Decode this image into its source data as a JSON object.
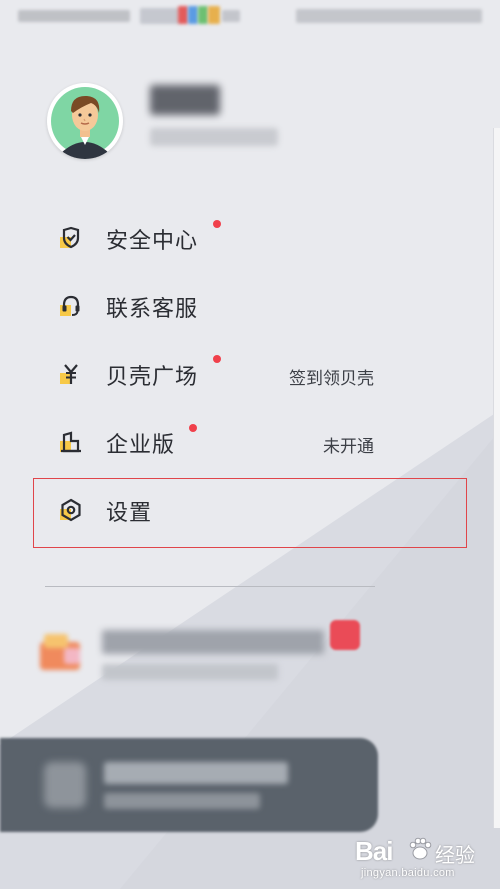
{
  "menu": {
    "items": [
      {
        "label": "安全中心",
        "icon": "shield-icon",
        "badge": true,
        "right_text": ""
      },
      {
        "label": "联系客服",
        "icon": "headset-icon",
        "badge": false,
        "right_text": ""
      },
      {
        "label": "贝壳广场",
        "icon": "yen-icon",
        "badge": true,
        "right_text": "签到领贝壳"
      },
      {
        "label": "企业版",
        "icon": "enterprise-icon",
        "badge": true,
        "right_text": "未开通"
      },
      {
        "label": "设置",
        "icon": "settings-icon",
        "badge": false,
        "right_text": ""
      }
    ]
  },
  "watermark": {
    "brand": "Bai",
    "suffix": "经验",
    "url": "jingyan.baidu.com"
  },
  "colors": {
    "accent_yellow": "#f7c948",
    "icon_dark": "#2b2d33",
    "badge_red": "#f0404b",
    "highlight_border": "#e0454a",
    "bottom_bar": "#5a626b"
  }
}
